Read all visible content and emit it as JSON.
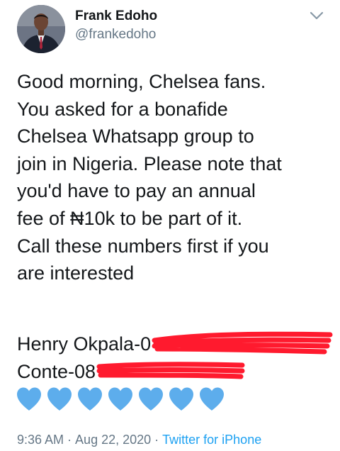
{
  "tweet": {
    "author": {
      "display_name": "Frank Edoho",
      "handle": "@frankedoho",
      "avatar_icon": "profile-photo"
    },
    "menu_icon": "chevron-down-icon",
    "text_lines": [
      "Good morning, Chelsea fans.",
      "You asked for a bonafide",
      "Chelsea Whatsapp group to",
      "join in Nigeria. Please note that",
      "you'd have to pay an annual",
      "fee of ₦10k to be part of it.",
      "Call these numbers first if you",
      "are interested"
    ],
    "contacts": [
      {
        "label": "Henry Okpala-0",
        "redacted": true
      },
      {
        "label": "Conte-08",
        "redacted": true
      }
    ],
    "hearts": {
      "icon": "blue-heart-icon",
      "count": 7,
      "color": "#5dadec"
    },
    "meta": {
      "time": "9:36 AM",
      "date": "Aug 22, 2020",
      "separator": "·",
      "source": "Twitter for iPhone"
    },
    "colors": {
      "text": "#14171a",
      "secondary": "#657786",
      "link": "#1da1f2",
      "redaction": "#ff1a2e"
    }
  }
}
